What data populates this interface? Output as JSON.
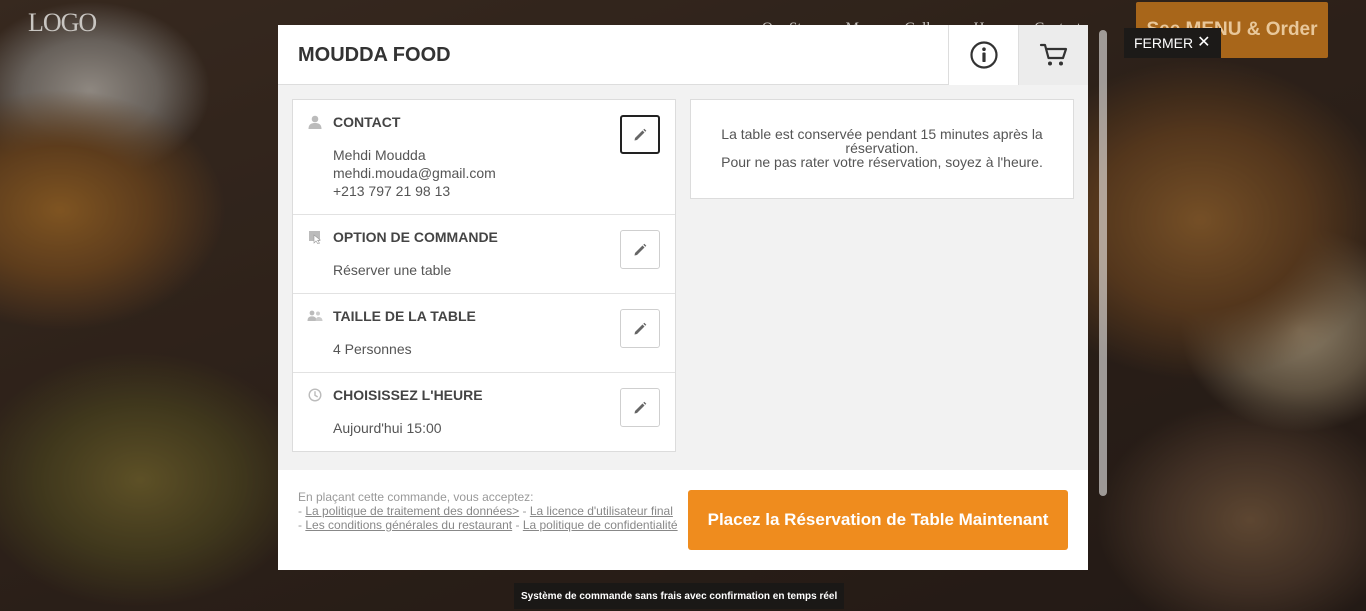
{
  "site": {
    "logo": "LOGO",
    "nav": [
      "Our Story",
      "Menu",
      "Gallery",
      "Hours",
      "Contact"
    ],
    "menu_button": "See MENU & Order"
  },
  "close_label": "FERMER",
  "restaurant_name": "MOUDDA FOOD",
  "header_icons": {
    "info": "info-icon",
    "cart": "cart-icon"
  },
  "sections": {
    "contact": {
      "title": "CONTACT",
      "name": "Mehdi Moudda",
      "email": "mehdi.mouda@gmail.com",
      "phone": "+213 797 21 98 13",
      "icon": "person-icon"
    },
    "order_option": {
      "title": "OPTION DE COMMANDE",
      "value": "Réserver une table",
      "icon": "table-option-icon"
    },
    "table_size": {
      "title": "TAILLE DE LA TABLE",
      "value": "4 Personnes",
      "icon": "people-icon"
    },
    "time": {
      "title": "CHOISISSEZ L'HEURE",
      "value": "Aujourd'hui 15:00",
      "icon": "clock-icon"
    }
  },
  "notice": {
    "line1": "La table est conservée pendant 15 minutes après la réservation.",
    "line2": "Pour ne pas rater votre réservation, soyez à l'heure."
  },
  "terms": {
    "intro": "En plaçant cette commande, vous acceptez:",
    "dash": "- ",
    "sep": " - ",
    "link_data_policy": "La politique de traitement des données>",
    "link_user_license": "La licence d'utilisateur final",
    "link_conditions": "Les conditions générales du restaurant",
    "link_privacy": "La politique de confidentialité"
  },
  "place_button": "Placez la Réservation de Table Maintenant",
  "footer_note": "Système de commande sans frais avec confirmation en temps réel",
  "colors": {
    "accent": "#ef8c1e",
    "site_menu_button": "#a8661a"
  }
}
